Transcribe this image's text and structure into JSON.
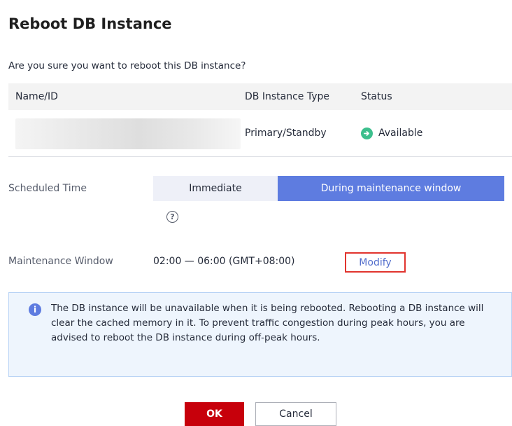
{
  "dialog": {
    "title": "Reboot DB Instance",
    "question": "Are you sure you want to reboot this DB instance?"
  },
  "table": {
    "headers": {
      "name": "Name/ID",
      "type": "DB Instance Type",
      "status": "Status"
    },
    "rows": [
      {
        "name": "",
        "type": "Primary/Standby",
        "status": "Available",
        "status_icon": "arrow-right-circle-icon",
        "status_color": "#3cbf8d"
      }
    ]
  },
  "scheduled_time": {
    "label": "Scheduled Time",
    "options": [
      "Immediate",
      "During maintenance window"
    ],
    "selected": "During maintenance window",
    "help_icon": "question-circle-icon"
  },
  "maintenance_window": {
    "label": "Maintenance Window",
    "value": "02:00 — 06:00 (GMT+08:00)",
    "modify_label": "Modify"
  },
  "notice": {
    "icon": "info-circle-icon",
    "text": "The DB instance will be unavailable when it is being rebooted. Rebooting a DB instance will clear the cached memory in it. To prevent traffic congestion during peak hours, you are advised to reboot the DB instance during off-peak hours."
  },
  "buttons": {
    "ok": "OK",
    "cancel": "Cancel"
  },
  "colors": {
    "primary_blue": "#5e7ce0",
    "ok_red": "#c7000b",
    "highlight_border": "#e1342e",
    "link": "#526ecc"
  }
}
